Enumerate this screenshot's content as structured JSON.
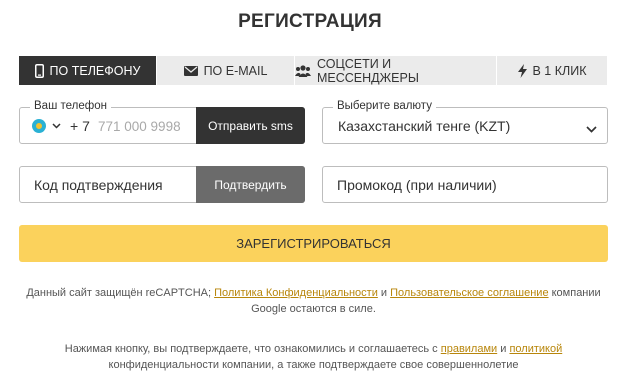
{
  "title": "РЕГИСТРАЦИЯ",
  "tabs": [
    {
      "label": "ПО ТЕЛЕФОНУ",
      "icon": "phone-icon",
      "active": true
    },
    {
      "label": "ПО E-MAIL",
      "icon": "envelope-icon",
      "active": false
    },
    {
      "label": "СОЦСЕТИ И МЕССЕНДЖЕРЫ",
      "icon": "users-icon",
      "active": false
    },
    {
      "label": "В 1 КЛИК",
      "icon": "lightning-icon",
      "active": false
    }
  ],
  "phone": {
    "legend": "Ваш телефон",
    "country_prefix": "+ 7",
    "placeholder": "771 000 9998",
    "flag_icon": "kazakhstan-flag-icon",
    "send_sms_label": "Отправить sms"
  },
  "currency": {
    "legend": "Выберите валюту",
    "selected": "Казахстанский тенге (KZT)"
  },
  "code": {
    "placeholder": "Код подтверждения",
    "confirm_label": "Подтвердить"
  },
  "promo": {
    "placeholder": "Промокод (при наличии)"
  },
  "register_label": "ЗАРЕГИСТРИРОВАТЬСЯ",
  "recaptcha_notice": {
    "prefix": "Данный сайт защищён reCAPTCHA; ",
    "privacy_link": "Политика Конфиденциальности",
    "and": " и ",
    "terms_link": "Пользовательское соглашение",
    "suffix": " компании Google остаются в силе."
  },
  "consent_notice": {
    "prefix": "Нажимая кнопку, вы подтверждаете, что ознакомились и соглашаетесь с ",
    "rules_link": "правилами",
    "and": " и ",
    "policy_link": "политикой",
    "suffix": " конфиденциальности компании, а также подтверждаете свое совершеннолетие"
  },
  "colors": {
    "dark": "#333333",
    "tab_inactive": "#ebebeb",
    "accent_yellow": "#fbd25c",
    "link": "#b8860b",
    "confirm_gray": "#6b6b6b"
  }
}
